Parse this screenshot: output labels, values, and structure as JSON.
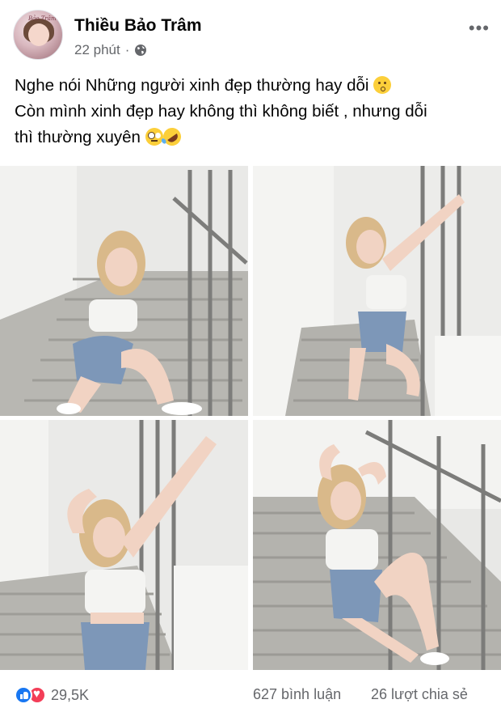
{
  "post": {
    "author": "Thiều Bảo Trâm",
    "time": "22 phút",
    "separator": "·",
    "privacy_icon": "globe-icon",
    "more_icon": "ellipsis-icon",
    "avatar_text": "Bảo Trâm",
    "text_lines": [
      "Nghe nói Những người xinh đẹp thường hay dỗi",
      "Còn mình xinh đẹp hay không thì không biết , nhưng dỗi",
      "thì thường xuyên"
    ],
    "emojis": [
      "kissing-face",
      "face-with-rolling-eyes",
      "rolling-on-floor-laughing"
    ]
  },
  "photos": [
    {
      "subject": "woman-kneeling-on-stairs"
    },
    {
      "subject": "woman-leaning-on-wall-stairs"
    },
    {
      "subject": "woman-arm-raised-stairs"
    },
    {
      "subject": "woman-sitting-on-stairs"
    }
  ],
  "footer": {
    "reactions": [
      "like-icon",
      "love-icon"
    ],
    "reaction_count": "29,5K",
    "comments": "627 bình luận",
    "shares": "26 lượt chia sẻ"
  },
  "colors": {
    "text": "#050505",
    "secondary": "#65676b",
    "like_blue": "#1877f2",
    "love_red": "#f33e58"
  }
}
